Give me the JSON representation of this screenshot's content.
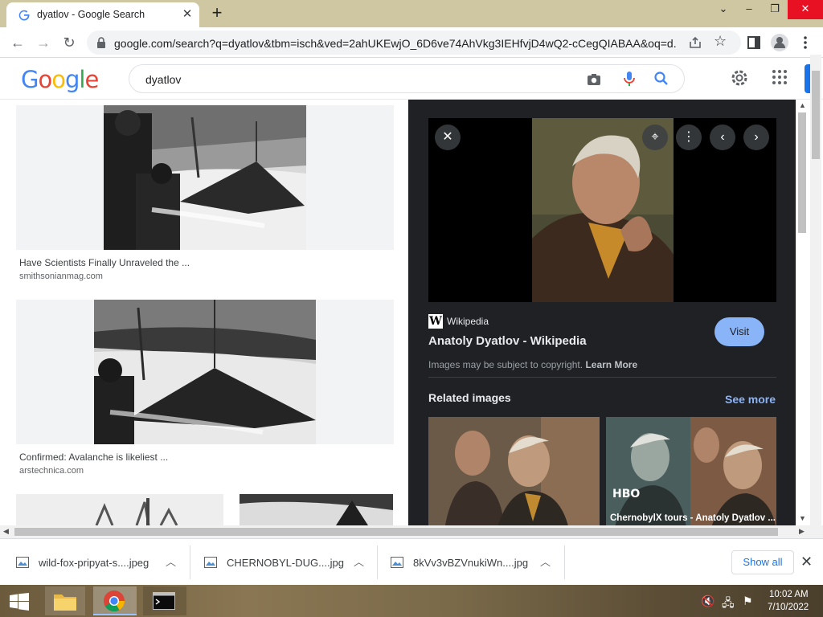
{
  "browser": {
    "tab_title": "dyatlov - Google Search",
    "url": "google.com/search?q=dyatlov&tbm=isch&ved=2ahUKEwjO_6D6ve74AhVkg3IEHfvjD4wQ2-cCegQIABAA&oq=d...",
    "tab_close": "✕",
    "new_tab": "+"
  },
  "google": {
    "logo_letters": [
      "G",
      "o",
      "o",
      "g",
      "l",
      "e"
    ],
    "logo_colors": [
      "#4285f4",
      "#ea4335",
      "#fbbc05",
      "#4285f4",
      "#34a853",
      "#ea4335"
    ],
    "search_query": "dyatlov"
  },
  "results": [
    {
      "title": "Have Scientists Finally Unraveled the ...",
      "site": "smithsonianmag.com"
    },
    {
      "title": "Confirmed: Avalanche is likeliest ...",
      "site": "arstechnica.com"
    }
  ],
  "preview": {
    "source": "Wikipedia",
    "title": "Anatoly Dyatlov - Wikipedia",
    "visit": "Visit",
    "copyright": "Images may be subject to copyright.",
    "learn_more": "Learn More",
    "related_title": "Related images",
    "see_more": "See more",
    "related_caption": "ChernobylX tours - Anatoly Dyatlov ...",
    "hbo": "HBO"
  },
  "downloads": {
    "items": [
      "wild-fox-pripyat-s....jpeg",
      "CHERNOBYL-DUG....jpg",
      "8kVv3vBZVnukiWn....jpg"
    ],
    "show_all": "Show all"
  },
  "taskbar": {
    "time": "10:02 AM",
    "date": "7/10/2022"
  },
  "colors": {
    "accent": "#1a73e8",
    "visit_button": "#8ab4f8",
    "preview_bg": "#202124",
    "titlebar": "#cfc6a2"
  }
}
